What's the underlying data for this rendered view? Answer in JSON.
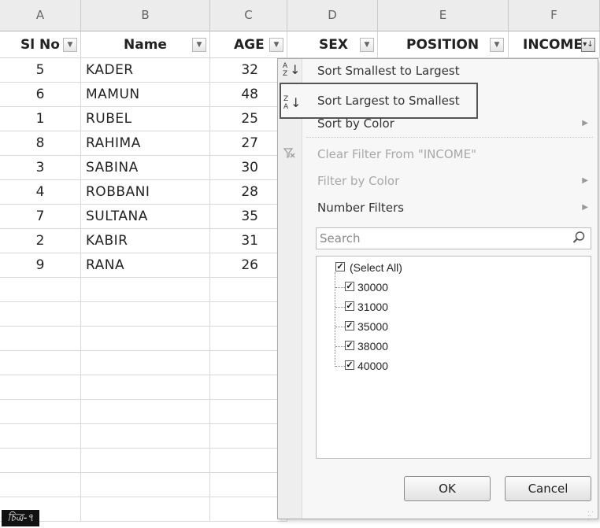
{
  "columns": [
    "A",
    "B",
    "C",
    "D",
    "E",
    "F"
  ],
  "headers": {
    "sl": "Sl No",
    "name": "Name",
    "age": "AGE",
    "sex": "SEX",
    "position": "POSITION",
    "income": "INCOME"
  },
  "rows": [
    {
      "sl": "5",
      "name": "KADER",
      "age": "32"
    },
    {
      "sl": "6",
      "name": "MAMUN",
      "age": "48"
    },
    {
      "sl": "1",
      "name": "RUBEL",
      "age": "25"
    },
    {
      "sl": "8",
      "name": "RAHIMA",
      "age": "27"
    },
    {
      "sl": "3",
      "name": "SABINA",
      "age": "30"
    },
    {
      "sl": "4",
      "name": "ROBBANI",
      "age": "28"
    },
    {
      "sl": "7",
      "name": "SULTANA",
      "age": "35"
    },
    {
      "sl": "2",
      "name": "KABIR",
      "age": "31"
    },
    {
      "sl": "9",
      "name": "RANA",
      "age": "26"
    }
  ],
  "menu": {
    "sort_asc": "Sort Smallest to Largest",
    "sort_desc": "Sort Largest to Smallest",
    "sort_by_color": "Sort by Color",
    "clear_filter": "Clear Filter From \"INCOME\"",
    "filter_by_color": "Filter by Color",
    "number_filters": "Number Filters",
    "search_placeholder": "Search",
    "list_items": [
      "(Select All)",
      "30000",
      "31000",
      "35000",
      "38000",
      "40000"
    ],
    "ok": "OK",
    "cancel": "Cancel",
    "icon_names": [
      "sort-ascending-icon",
      "sort-descending-icon",
      "clear-filter-icon",
      "search-icon",
      "checkbox-checked-icon",
      "submenu-arrow-icon"
    ]
  },
  "caption": "চিত্র-৭",
  "colors": {
    "highlight_border": "#555555",
    "header_bg": "#ececec",
    "menu_bg": "#f7f7f7",
    "caption_bg": "#111111"
  }
}
